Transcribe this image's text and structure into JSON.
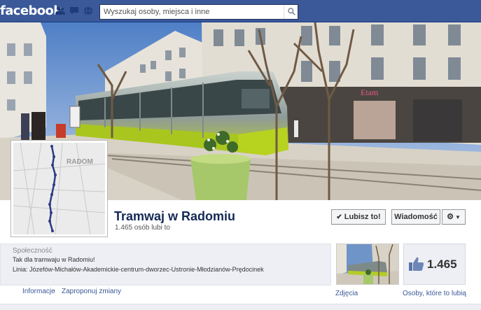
{
  "header": {
    "logo": "facebook",
    "search_placeholder": "Wyszukaj osoby, miejsca i inne",
    "icons": [
      "friend-requests-icon",
      "messages-icon",
      "notifications-icon",
      "search-icon"
    ]
  },
  "cover": {
    "storefront_sign": "Etam"
  },
  "profile_picture": {
    "map_title": "RADOM"
  },
  "page": {
    "title": "Tramwaj w Radomiu",
    "likes_text": "1.465 osób lubi to",
    "like_button": "Lubisz to!",
    "message_button": "Wiadomość",
    "category": "Społeczność",
    "about": "Tak dla tramwaju w Radomiu!",
    "route": "Linia: Józefów-Michałów-Akademickie-centrum-dworzec-Ustronie-Młodzianów-Prędocinek",
    "link_info": "Informacje",
    "link_separator": "·",
    "link_suggest": "Zaproponuj zmiany"
  },
  "apps": {
    "photos_label": "Zdjęcia",
    "likes_count": "1.465",
    "likes_label": "Osoby, które to lubią"
  },
  "colors": {
    "facebook_blue": "#3b5998",
    "tram_green": "#a6c21f",
    "link": "#3b5998"
  }
}
